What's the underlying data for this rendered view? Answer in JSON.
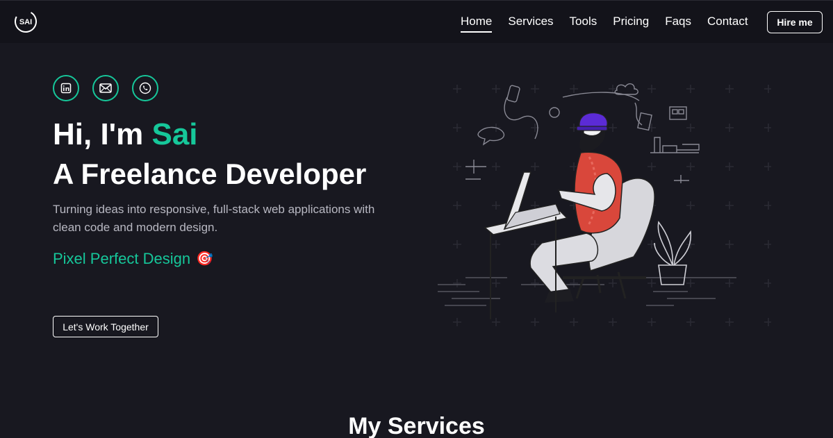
{
  "nav": {
    "logo_text": "SAI",
    "links": [
      "Home",
      "Services",
      "Tools",
      "Pricing",
      "Faqs",
      "Contact"
    ],
    "active": "Home",
    "hire_label": "Hire me"
  },
  "hero": {
    "socials": [
      "linkedin-icon",
      "mail-icon",
      "phone-icon"
    ],
    "greeting": "Hi, I'm ",
    "name": "Sai",
    "role": "A Freelance Developer",
    "description": "Turning ideas into responsive, full-stack web applications with clean code and modern design.",
    "typed_text": "Pixel Perfect Design",
    "typed_emoji": "🎯",
    "cta_label": "Let's Work Together"
  },
  "services": {
    "title": "My Services"
  },
  "colors": {
    "accent": "#16c79a",
    "background": "#181820",
    "nav_bg": "#13131a",
    "hat": "#5b2bd6",
    "vest": "#d9473b"
  }
}
